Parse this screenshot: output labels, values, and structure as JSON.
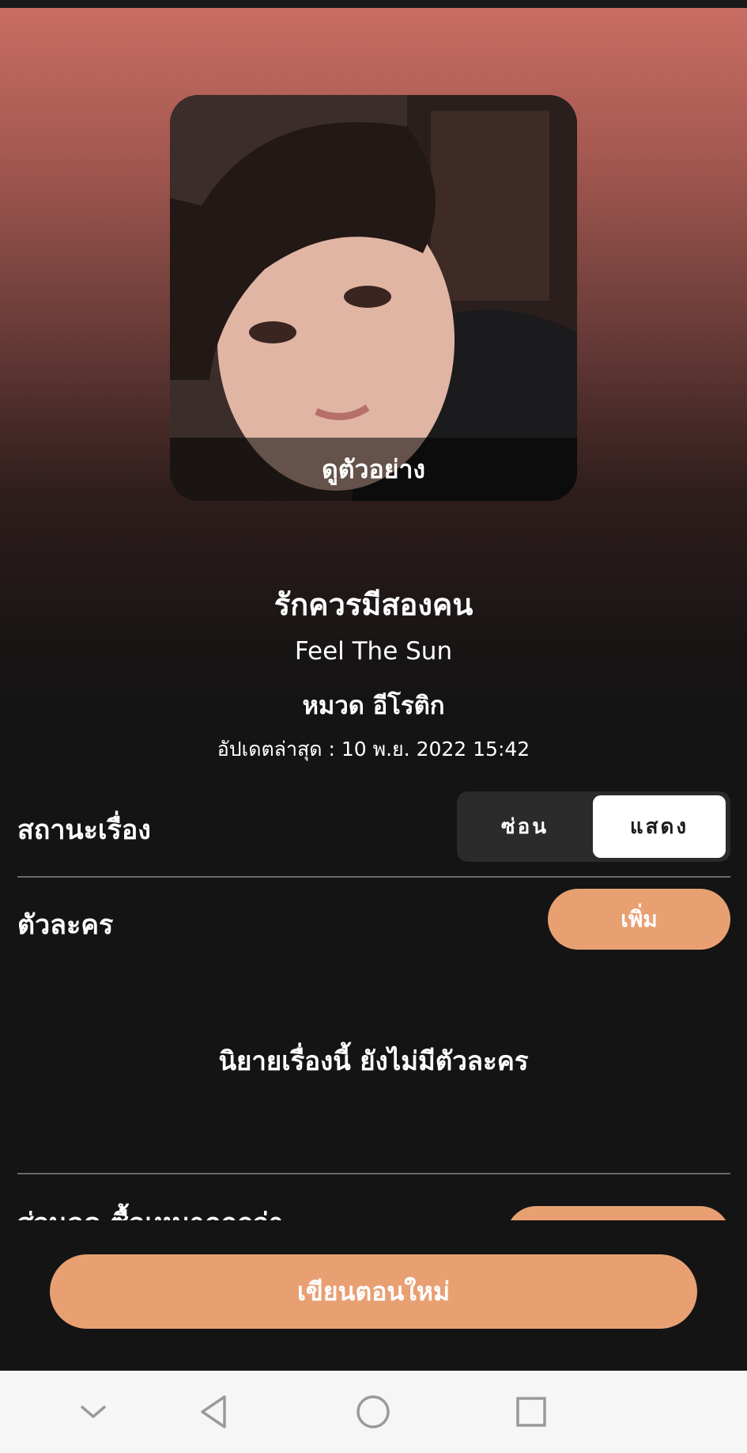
{
  "cover": {
    "preview_label": "ดูตัวอย่าง"
  },
  "story": {
    "title": "รักควรมีสองคน",
    "author": "Feel The Sun",
    "category": "หมวด อีโรติก",
    "updated": "อัปเดตล่าสุด : 10 พ.ย. 2022 15:42"
  },
  "status": {
    "label": "สถานะเรื่อง",
    "options": [
      "ซ่อน",
      "แสดง"
    ],
    "selected": "แสดง"
  },
  "characters": {
    "label": "ตัวละคร",
    "add_label": "เพิ่ม",
    "empty_message": "นิยายเรื่องนี้ ยังไม่มีตัวละคร"
  },
  "discount": {
    "label": "ส่วนลด ซื้อเหมาถูกกว่า"
  },
  "actions": {
    "write_new_label": "เขียนตอนใหม่"
  },
  "colors": {
    "accent": "#e8a073",
    "background": "#141414",
    "hero_top": "#c96d63"
  },
  "navbar": {
    "icons": [
      "chevron-down-icon",
      "back-triangle-icon",
      "home-circle-icon",
      "recents-square-icon"
    ]
  }
}
